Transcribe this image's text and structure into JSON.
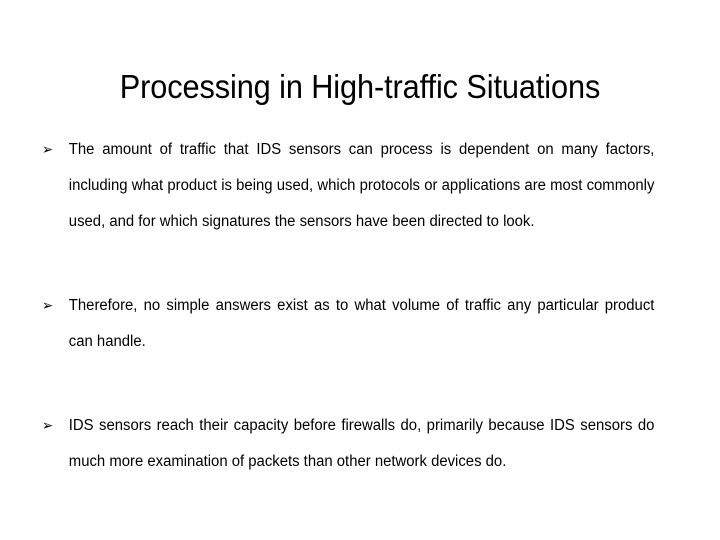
{
  "slide": {
    "title": "Processing in High-traffic Situations",
    "background_color": "#ffffff",
    "text_color": "#000000",
    "bullet_glyph": "➢",
    "bullet_icon_name": "wingdings-arrow-bullet",
    "bullets": [
      {
        "text": "The amount of traffic that IDS sensors can process is dependent on many factors, including what product is being used, which protocols or applications are most commonly used, and for which signatures the sensors have been directed to look."
      },
      {
        "text": "Therefore, no simple answers exist as to what volume of traffic any particular product can handle."
      },
      {
        "text": "IDS sensors reach their capacity before firewalls do, primarily because IDS sensors do much more examination of packets than other network devices do."
      }
    ]
  }
}
